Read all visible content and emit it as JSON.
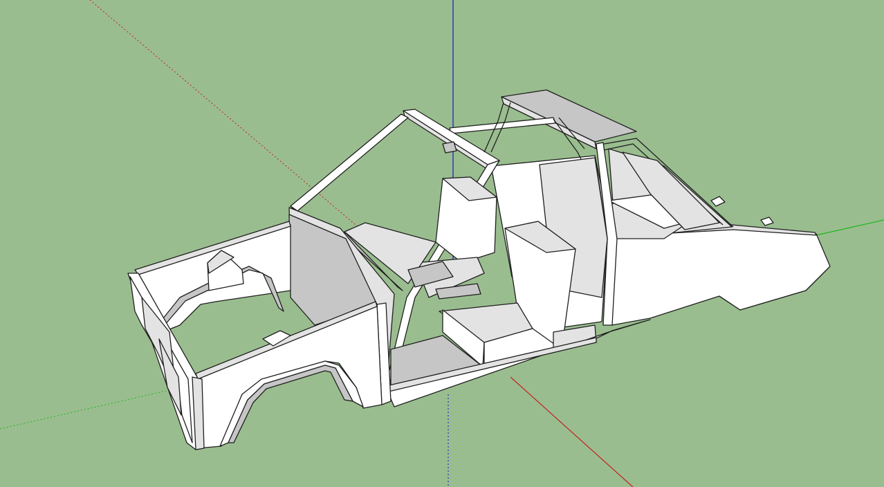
{
  "viewport": {
    "background_color": "#9abd8f",
    "axes": {
      "red_color": "#c42020",
      "green_color": "#18b818",
      "blue_color": "#1515cc",
      "dotted_color": "#555555"
    },
    "model": {
      "face_light": "#ffffff",
      "face_mid": "#e3e3e3",
      "face_dark": "#c6c6c6",
      "face_darker": "#b3b3b3",
      "edge_color": "#1e1e1e"
    }
  }
}
